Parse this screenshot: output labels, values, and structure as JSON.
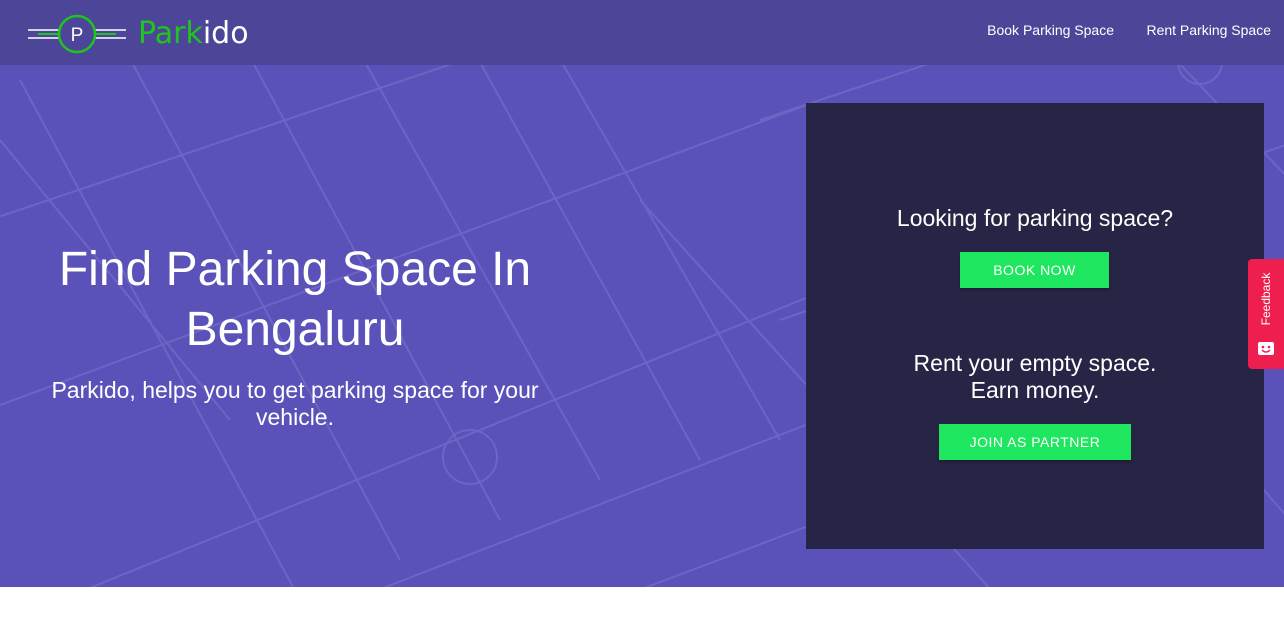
{
  "brand": {
    "logo_letter": "P",
    "name_part1": "Park",
    "name_part2": "ido",
    "logo_green": "#1ec51e"
  },
  "nav": {
    "book_label": "Book Parking Space",
    "rent_label": "Rent Parking Space"
  },
  "hero": {
    "title_line1": "Find Parking Space In",
    "title_line2": "Bengaluru",
    "subtitle": "Parkido, helps you to get parking space for your vehicle."
  },
  "card": {
    "question": "Looking for parking space?",
    "book_button": "BOOK NOW",
    "rent_line1": "Rent your empty space.",
    "rent_line2": "Earn money.",
    "partner_button": "JOIN AS PARTNER"
  },
  "feedback": {
    "label": "Feedback",
    "icon": "smiley-face-icon"
  },
  "colors": {
    "hero_bg": "#5a52b8",
    "navbar_bg": "#4d4698",
    "card_bg": "#262545",
    "button_green": "#1ee65f",
    "feedback_red": "#ee1e4e"
  }
}
